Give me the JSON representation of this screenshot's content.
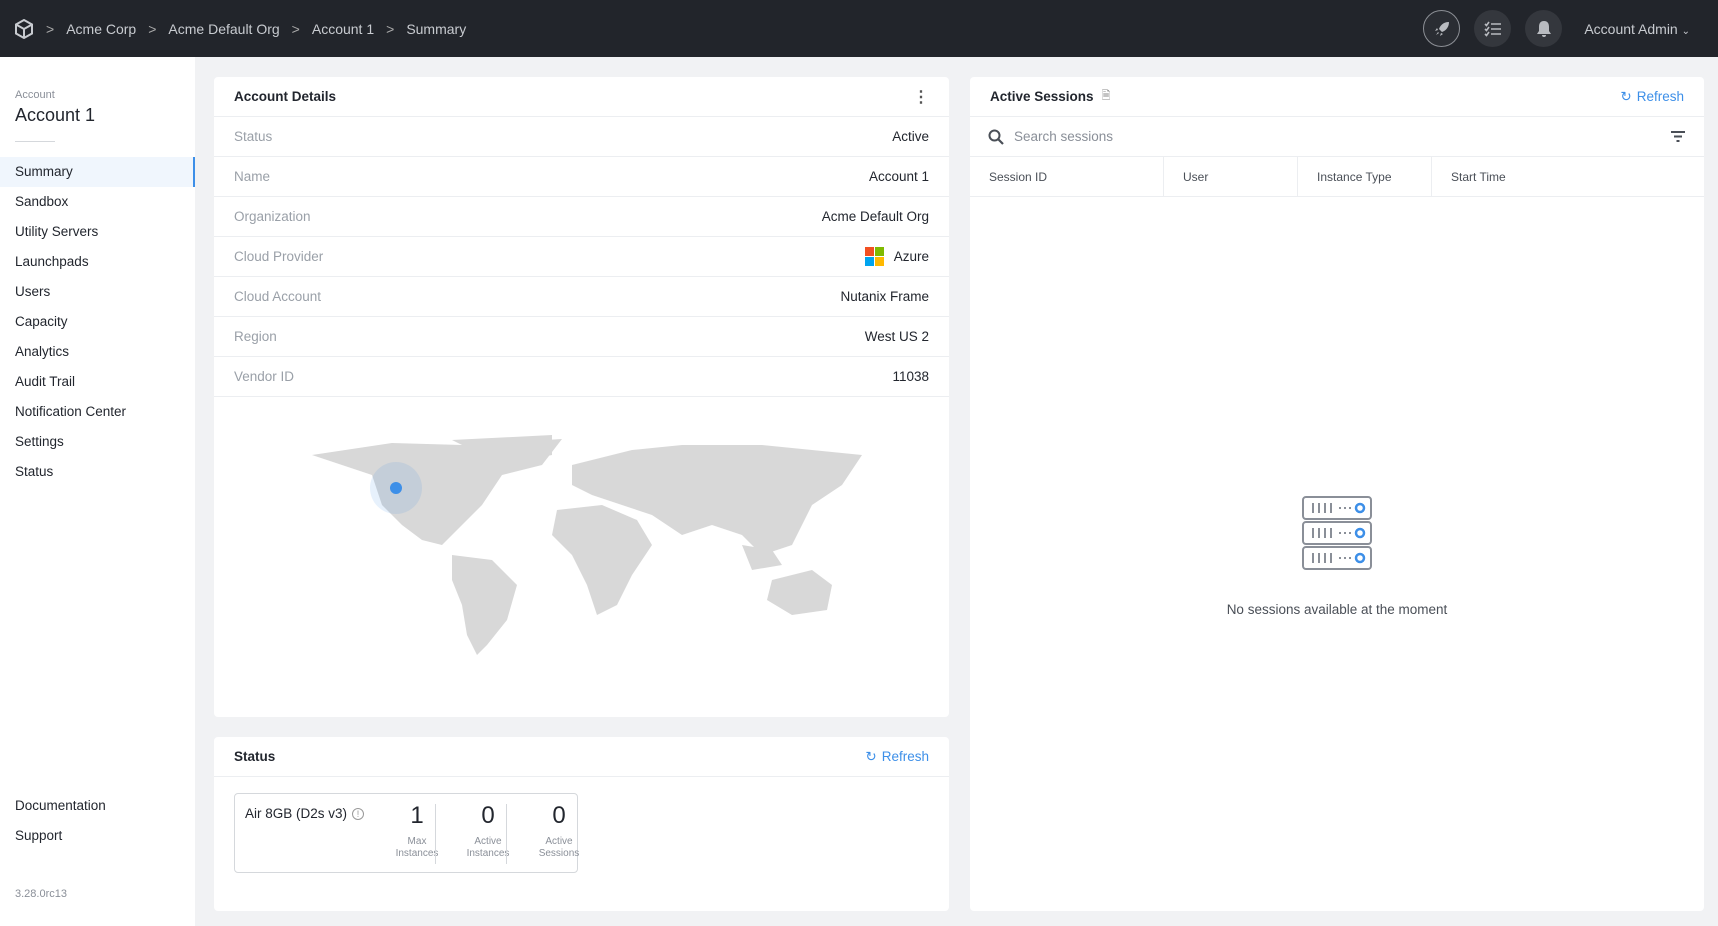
{
  "header": {
    "breadcrumb": [
      "Acme Corp",
      "Acme Default Org",
      "Account 1",
      "Summary"
    ],
    "user_menu": "Account Admin",
    "icons": [
      "logo-cube-icon",
      "rocket-icon",
      "task-list-icon",
      "bell-icon",
      "chevron-down-icon"
    ]
  },
  "sidebar": {
    "caption": "Account",
    "title": "Account 1",
    "items": [
      {
        "label": "Summary",
        "active": true
      },
      {
        "label": "Sandbox"
      },
      {
        "label": "Utility Servers"
      },
      {
        "label": "Launchpads"
      },
      {
        "label": "Users"
      },
      {
        "label": "Capacity"
      },
      {
        "label": "Analytics"
      },
      {
        "label": "Audit Trail"
      },
      {
        "label": "Notification Center"
      },
      {
        "label": "Settings"
      },
      {
        "label": "Status"
      }
    ],
    "bottom": [
      {
        "label": "Documentation"
      },
      {
        "label": "Support"
      }
    ],
    "version": "3.28.0rc13"
  },
  "account_details": {
    "title": "Account Details",
    "rows": [
      {
        "key": "Status",
        "value": "Active"
      },
      {
        "key": "Name",
        "value": "Account 1"
      },
      {
        "key": "Organization",
        "value": "Acme Default Org"
      },
      {
        "key": "Cloud Provider",
        "value": "Azure"
      },
      {
        "key": "Cloud Account",
        "value": "Nutanix Frame"
      },
      {
        "key": "Region",
        "value": "West US 2"
      },
      {
        "key": "Vendor ID",
        "value": "11038"
      }
    ],
    "accent": "#3d8fe8"
  },
  "status": {
    "title": "Status",
    "refresh": "Refresh",
    "instance": "Air 8GB (D2s v3)",
    "metrics": [
      {
        "value": "1",
        "label1": "Max",
        "label2": "Instances"
      },
      {
        "value": "0",
        "label1": "Active",
        "label2": "Instances"
      },
      {
        "value": "0",
        "label1": "Active",
        "label2": "Sessions"
      }
    ]
  },
  "sessions": {
    "title": "Active Sessions",
    "refresh": "Refresh",
    "search_placeholder": "Search sessions",
    "columns": [
      "Session ID",
      "User",
      "Instance Type",
      "Start Time"
    ],
    "empty": "No sessions available at the moment"
  }
}
